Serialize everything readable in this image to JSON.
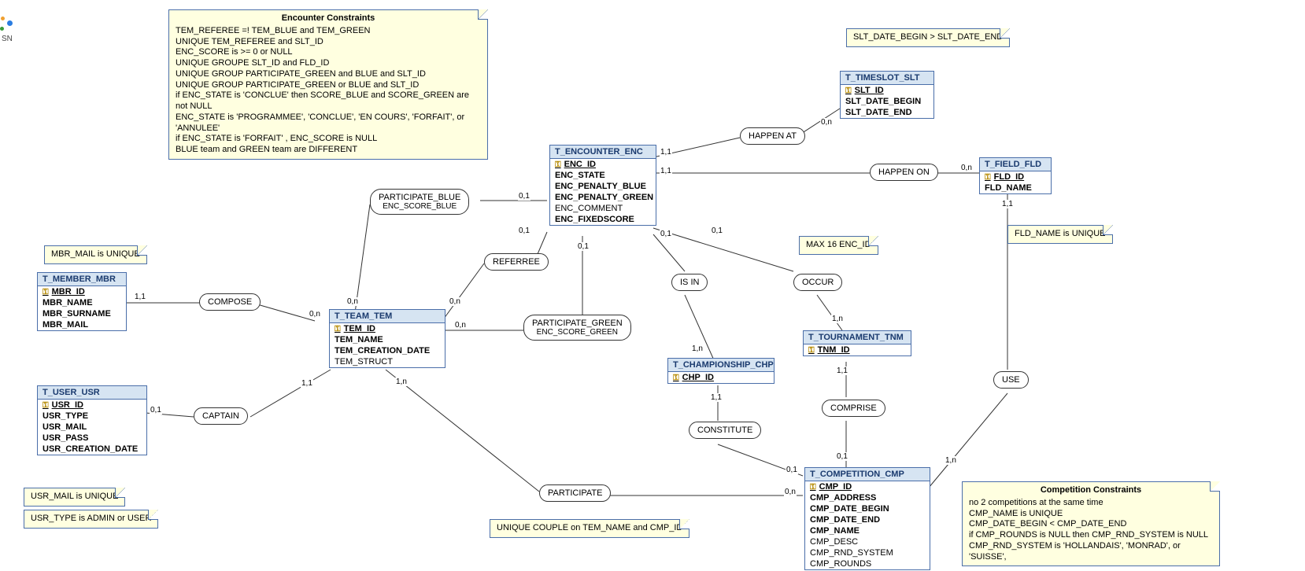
{
  "entities": {
    "encounter": {
      "title": "T_ENCOUNTER_ENC",
      "pk": "ENC_ID",
      "f": [
        "ENC_STATE",
        "ENC_PENALTY_BLUE",
        "ENC_PENALTY_GREEN",
        "ENC_COMMENT",
        "ENC_FIXEDSCORE"
      ]
    },
    "timeslot": {
      "title": "T_TIMESLOT_SLT",
      "pk": "SLT_ID",
      "f": [
        "SLT_DATE_BEGIN",
        "SLT_DATE_END"
      ]
    },
    "field": {
      "title": "T_FIELD_FLD",
      "pk": "FLD_ID",
      "f": [
        "FLD_NAME"
      ]
    },
    "team": {
      "title": "T_TEAM_TEM",
      "pk": "TEM_ID",
      "f": [
        "TEM_NAME",
        "TEM_CREATION_DATE",
        "TEM_STRUCT"
      ]
    },
    "member": {
      "title": "T_MEMBER_MBR",
      "pk": "MBR_ID",
      "f": [
        "MBR_NAME",
        "MBR_SURNAME",
        "MBR_MAIL"
      ]
    },
    "user": {
      "title": "T_USER_USR",
      "pk": "USR_ID",
      "f": [
        "USR_TYPE",
        "USR_MAIL",
        "USR_PASS",
        "USR_CREATION_DATE"
      ]
    },
    "championship": {
      "title": "T_CHAMPIONSHIP_CHP",
      "pk": "CHP_ID"
    },
    "tournament": {
      "title": "T_TOURNAMENT_TNM",
      "pk": "TNM_ID"
    },
    "competition": {
      "title": "T_COMPETITION_CMP",
      "pk": "CMP_ID",
      "fb": [
        "CMP_ADDRESS",
        "CMP_DATE_BEGIN",
        "CMP_DATE_END",
        "CMP_NAME"
      ],
      "f": [
        "CMP_DESC",
        "CMP_RND_SYSTEM",
        "CMP_ROUNDS"
      ]
    }
  },
  "rel": {
    "happen_at": "HAPPEN AT",
    "happen_on": "HAPPEN ON",
    "referree": "REFERREE",
    "p_blue": {
      "t": "PARTICIPATE_BLUE",
      "s": "ENC_SCORE_BLUE"
    },
    "p_green": {
      "t": "PARTICIPATE_GREEN",
      "s": "ENC_SCORE_GREEN"
    },
    "is_in": "IS IN",
    "occur": "OCCUR",
    "compose": "COMPOSE",
    "captain": "CAPTAIN",
    "constitute": "CONSTITUTE",
    "comprise": "COMPRISE",
    "use": "USE",
    "participate": "PARTICIPATE"
  },
  "card": {
    "01": "0,1",
    "11": "1,1",
    "0n": "0,n",
    "1n": "1,n"
  },
  "notes": {
    "enc_title": "Encounter Constraints",
    "enc": [
      "TEM_REFEREE =! TEM_BLUE and TEM_GREEN",
      "UNIQUE TEM_REFEREE and SLT_ID",
      "ENC_SCORE is >= 0 or NULL",
      "UNIQUE GROUPE SLT_ID and FLD_ID",
      "UNIQUE GROUP PARTICIPATE_GREEN and BLUE and SLT_ID",
      "UNIQUE GROUP PARTICIPATE_GREEN or BLUE and SLT_ID",
      "if ENC_STATE is 'CONCLUE' then SCORE_BLUE and SCORE_GREEN are not NULL",
      "ENC_STATE is 'PROGRAMMEE', 'CONCLUE', 'EN COURS', 'FORFAIT', or 'ANNULEE'",
      "if ENC_STATE is 'FORFAIT' , ENC_SCORE is NULL",
      "BLUE team and GREEN team are DIFFERENT"
    ],
    "slt": "SLT_DATE_BEGIN > SLT_DATE_END",
    "mbr": "MBR_MAIL is UNIQUE",
    "fld": "FLD_NAME is UNIQUE",
    "max16": "MAX 16 ENC_ID",
    "usr1": "USR_MAIL is UNIQUE",
    "usr2": "USR_TYPE is ADMIN or USER",
    "part": "UNIQUE COUPLE on TEM_NAME and CMP_ID",
    "cmp_title": "Competition Constraints",
    "cmp": [
      "no 2 competitions at the same time",
      "CMP_NAME is UNIQUE",
      "CMP_DATE_BEGIN < CMP_DATE_END",
      "if CMP_ROUNDS is NULL then CMP_RND_SYSTEM is NULL",
      "CMP_RND_SYSTEM is 'HOLLANDAIS', 'MONRAD', or  'SUISSE',"
    ]
  },
  "sidetext": "SN"
}
